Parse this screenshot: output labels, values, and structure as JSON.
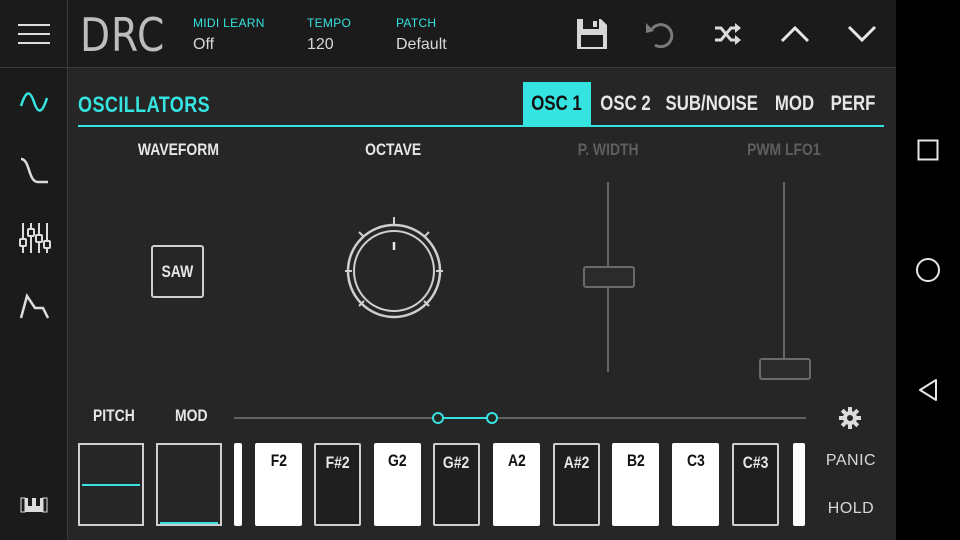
{
  "app": {
    "title": "DRC",
    "accent_color": "#35e3e0"
  },
  "header": {
    "fields": [
      {
        "label": "MIDI LEARN",
        "value": "Off"
      },
      {
        "label": "TEMPO",
        "value": "120"
      },
      {
        "label": "PATCH",
        "value": "Default"
      }
    ],
    "buttons": [
      "save-icon",
      "undo-icon",
      "shuffle-icon",
      "chevron-up-icon",
      "chevron-down-icon"
    ]
  },
  "sidebar": {
    "items": [
      "oscillator-wave-icon",
      "filter-icon",
      "mixer-sliders-icon",
      "envelope-icon"
    ],
    "bottom": "keyboard-icon"
  },
  "section": {
    "title": "OSCILLATORS",
    "tabs": [
      {
        "label": "OSC 1",
        "active": true
      },
      {
        "label": "OSC 2",
        "active": false
      },
      {
        "label": "SUB/NOISE",
        "active": false
      },
      {
        "label": "MOD",
        "active": false
      },
      {
        "label": "PERF",
        "active": false
      }
    ]
  },
  "controls": {
    "waveform": {
      "label": "WAVEFORM",
      "value": "SAW"
    },
    "octave": {
      "label": "OCTAVE"
    },
    "pulse_width": {
      "label": "P. WIDTH",
      "enabled": false,
      "level": 0.5
    },
    "pwm_lfo": {
      "label": "PWM LFO1",
      "enabled": false,
      "level": 0.0
    }
  },
  "performance": {
    "pitch_label": "PITCH",
    "mod_label": "MOD",
    "pitch_level": 0.5,
    "mod_level": 0.0,
    "keys": [
      {
        "label": "F2",
        "type": "white"
      },
      {
        "label": "F#2",
        "type": "black"
      },
      {
        "label": "G2",
        "type": "white"
      },
      {
        "label": "G#2",
        "type": "black"
      },
      {
        "label": "A2",
        "type": "white"
      },
      {
        "label": "A#2",
        "type": "black"
      },
      {
        "label": "B2",
        "type": "white"
      },
      {
        "label": "C3",
        "type": "white"
      },
      {
        "label": "C#3",
        "type": "black"
      }
    ],
    "panic_label": "PANIC",
    "hold_label": "HOLD"
  },
  "system_nav": [
    "square-recents-icon",
    "circle-home-icon",
    "triangle-back-icon"
  ]
}
